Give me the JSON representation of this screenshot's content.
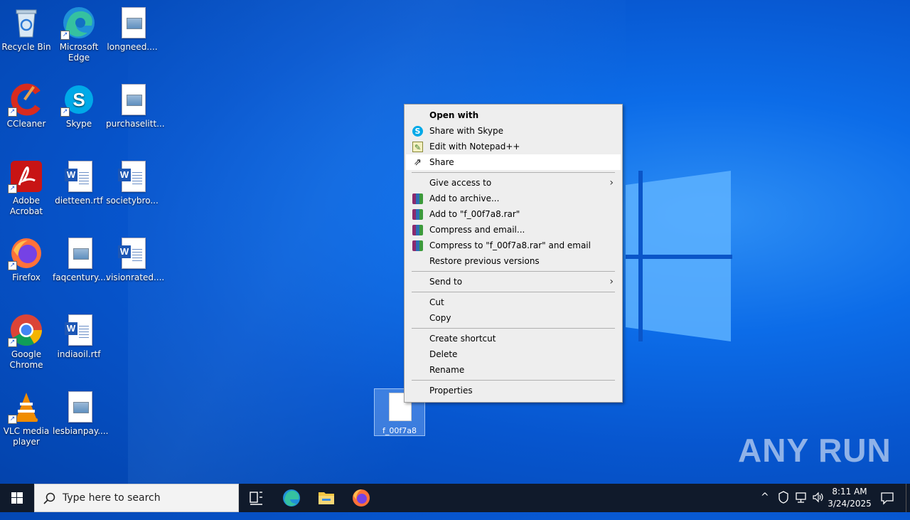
{
  "desktop_icons": [
    {
      "label": "Recycle Bin"
    },
    {
      "label": "Microsoft Edge"
    },
    {
      "label": "longneed...."
    },
    {
      "label": "CCleaner"
    },
    {
      "label": "Skype"
    },
    {
      "label": "purchaselitt..."
    },
    {
      "label": "Adobe Acrobat"
    },
    {
      "label": "dietteen.rtf"
    },
    {
      "label": "societybro..."
    },
    {
      "label": "Firefox"
    },
    {
      "label": "faqcentury...."
    },
    {
      "label": "visionrated...."
    },
    {
      "label": "Google Chrome"
    },
    {
      "label": "indiaoil.rtf"
    },
    {
      "label": "VLC media player"
    },
    {
      "label": "lesbianpay...."
    }
  ],
  "selected_file": {
    "label": "f_00f7a8"
  },
  "context_menu": {
    "items": [
      {
        "label": "Open with"
      },
      {
        "label": "Share with Skype"
      },
      {
        "label": "Edit with Notepad++"
      },
      {
        "label": "Share"
      },
      {
        "label": "Give access to"
      },
      {
        "label": "Add to archive..."
      },
      {
        "label": "Add to \"f_00f7a8.rar\""
      },
      {
        "label": "Compress and email..."
      },
      {
        "label": "Compress to \"f_00f7a8.rar\" and email"
      },
      {
        "label": "Restore previous versions"
      },
      {
        "label": "Send to"
      },
      {
        "label": "Cut"
      },
      {
        "label": "Copy"
      },
      {
        "label": "Create shortcut"
      },
      {
        "label": "Delete"
      },
      {
        "label": "Rename"
      },
      {
        "label": "Properties"
      }
    ]
  },
  "watermark": "ANY RUN",
  "taskbar": {
    "search_placeholder": "Type here to search",
    "time": "8:11 AM",
    "date": "3/24/2025"
  },
  "colors": {
    "desktop": "#0756cf",
    "taskbar": "#101a2b",
    "menu_bg": "#eeeeee"
  }
}
